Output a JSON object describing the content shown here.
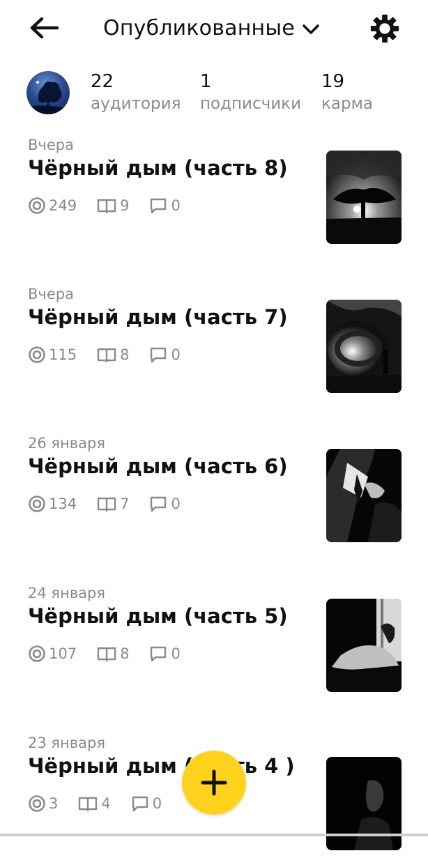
{
  "header": {
    "title": "Опубликованные"
  },
  "profile": {
    "stats": [
      {
        "value": "22",
        "label": "аудитория"
      },
      {
        "value": "1",
        "label": "подписчики"
      },
      {
        "value": "19",
        "label": "карма"
      }
    ]
  },
  "posts": [
    {
      "date": "Вчера",
      "title": "Чёрный дым (часть 8)",
      "views": "249",
      "reads": "9",
      "comments": "0"
    },
    {
      "date": "Вчера",
      "title": "Чёрный дым (часть 7)",
      "views": "115",
      "reads": "8",
      "comments": "0"
    },
    {
      "date": "26 января",
      "title": "Чёрный дым (часть 6)",
      "views": "134",
      "reads": "7",
      "comments": "0"
    },
    {
      "date": "24 января",
      "title": "Чёрный дым (часть 5)",
      "views": "107",
      "reads": "8",
      "comments": "0"
    },
    {
      "date": "23 января",
      "title": "Чёрный дым (часть 4 )",
      "views": "3",
      "reads": "4",
      "comments": "0"
    }
  ],
  "icons": {
    "back": "arrow-left-icon",
    "dropdown": "chevron-down-icon",
    "settings": "gear-icon",
    "views": "eye-circle-icon",
    "reads": "open-book-icon",
    "comments": "comment-bubble-icon",
    "add": "plus-icon"
  },
  "colors": {
    "accent": "#ffd21e",
    "text": "#111111",
    "muted": "#8a8a8a"
  }
}
